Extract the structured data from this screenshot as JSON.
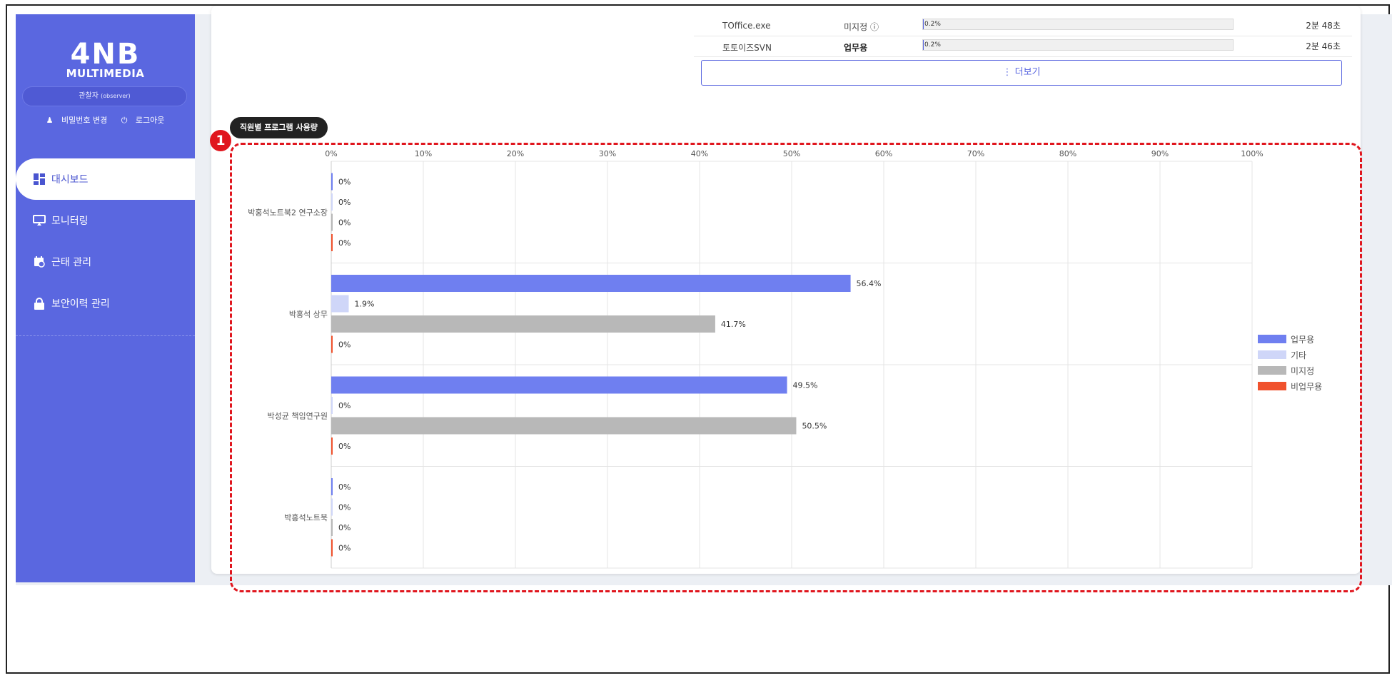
{
  "sidebar": {
    "logo_big": "4NB",
    "logo_small": "MULTIMEDIA",
    "role": "관찰자",
    "role_sub": "(observer)",
    "change_password": "비밀번호 변경",
    "logout": "로그아웃",
    "items": [
      {
        "label": "대시보드",
        "active": true
      },
      {
        "label": "모니터링",
        "active": false
      },
      {
        "label": "근태 관리",
        "active": false
      },
      {
        "label": "보안이력 관리",
        "active": false
      }
    ]
  },
  "programs": [
    {
      "name": "TOffice.exe",
      "category": "미지정",
      "percent_label": "0.2%",
      "percent": 0.2,
      "time": "2분 48초"
    },
    {
      "name": "토토이즈SVN",
      "category": "업무용",
      "percent_label": "0.2%",
      "percent": 0.2,
      "time": "2분 46초"
    }
  ],
  "more_button": "⋮ 더보기",
  "section_title": "직원별 프로그램 사용량",
  "badge": "1",
  "colors": {
    "accent": "#5a67e0",
    "work": "#6f7ff0",
    "other": "#cfd6f8",
    "unassigned": "#b8b8b8",
    "nonwork": "#f0522d",
    "highlight": "#e0161e"
  },
  "chart_data": {
    "type": "bar",
    "orientation": "horizontal",
    "xlim": [
      0,
      100
    ],
    "ticks": [
      "0%",
      "10%",
      "20%",
      "30%",
      "40%",
      "50%",
      "60%",
      "70%",
      "80%",
      "90%",
      "100%"
    ],
    "categories": [
      "박홍석노트북2 연구소장",
      "박홍석 상무",
      "박성균 책임연구원",
      "박홍석노트북"
    ],
    "series": [
      {
        "name": "업무용",
        "values": [
          0,
          56.4,
          49.5,
          0
        ],
        "labels": [
          "0%",
          "56.4%",
          "49.5%",
          "0%"
        ]
      },
      {
        "name": "기타",
        "values": [
          0,
          1.9,
          0,
          0
        ],
        "labels": [
          "0%",
          "1.9%",
          "0%",
          "0%"
        ]
      },
      {
        "name": "미지정",
        "values": [
          0,
          41.7,
          50.5,
          0
        ],
        "labels": [
          "0%",
          "41.7%",
          "50.5%",
          "0%"
        ]
      },
      {
        "name": "비업무용",
        "values": [
          0,
          0,
          0,
          0
        ],
        "labels": [
          "0%",
          "0%",
          "0%",
          "0%"
        ]
      }
    ],
    "grid": true,
    "legend": "right"
  }
}
